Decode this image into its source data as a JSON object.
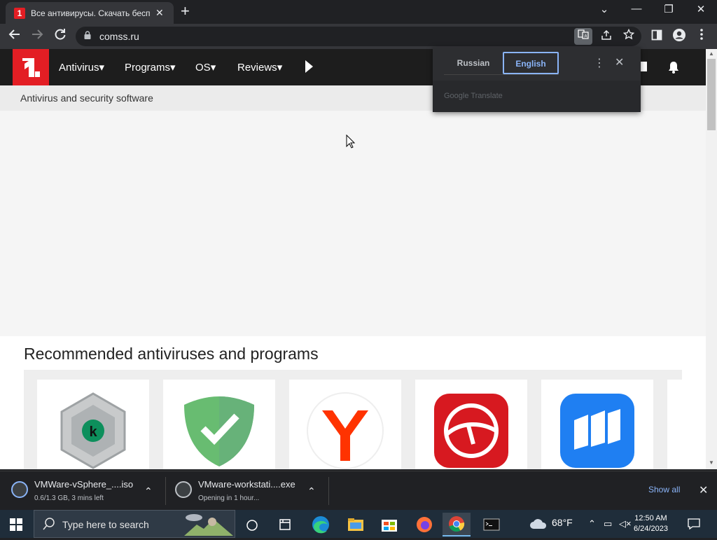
{
  "browser": {
    "tab_title": "Все антивирусы. Скачать беспла",
    "tab_close": "✕",
    "new_tab": "+",
    "url": "comss.ru",
    "window": {
      "minimize": "—",
      "restore": "❐",
      "close": "✕",
      "dropdown": "⌄"
    }
  },
  "site": {
    "logo_text": "1",
    "nav": [
      "Antivirus",
      "Programs",
      "OS",
      "Reviews"
    ],
    "subheader": "Antivirus and security software",
    "recommended_title": "Recommended antiviruses and programs"
  },
  "translate_popup": {
    "source_lang": "Russian",
    "target_lang": "English",
    "footer": "Google Translate"
  },
  "downloads": [
    {
      "name": "VMWare-vSphere_....iso",
      "status": "0.6/1.3 GB, 3 mins left"
    },
    {
      "name": "VMware-workstati....exe",
      "status": "Opening in 1 hour..."
    }
  ],
  "downloads_show_all": "Show all",
  "taskbar": {
    "search_placeholder": "Type here to search",
    "weather": "68°F",
    "time": "12:50 AM",
    "date": "6/24/2023"
  }
}
